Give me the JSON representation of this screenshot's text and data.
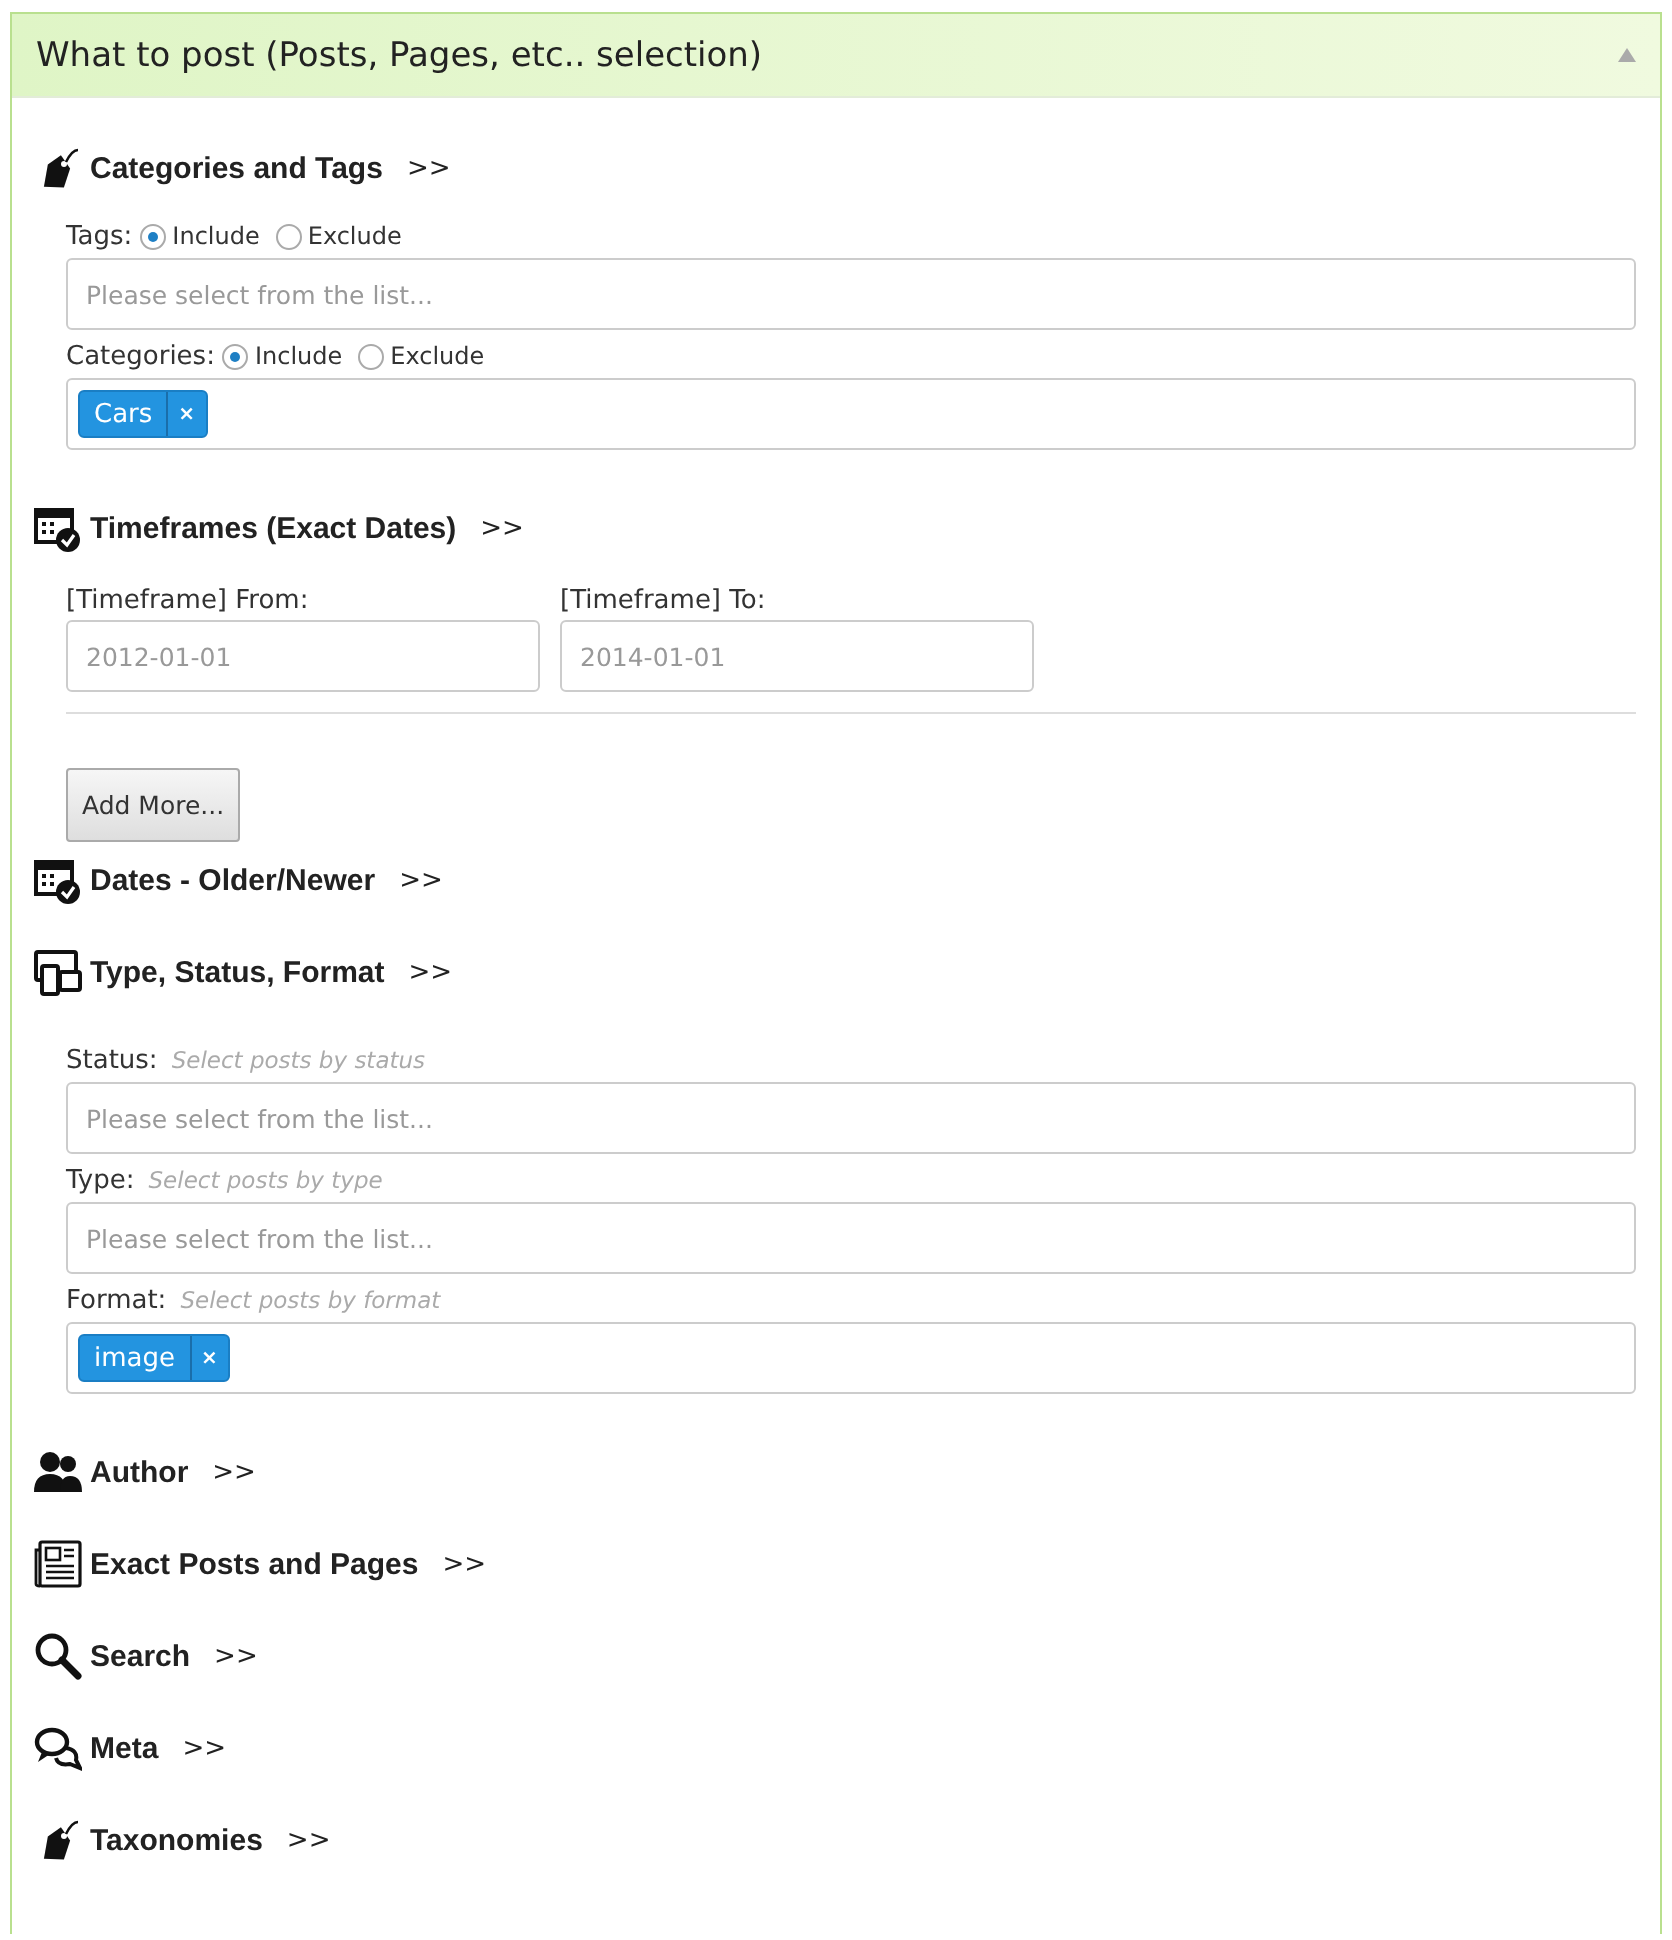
{
  "panel": {
    "title": "What to post (Posts, Pages, etc.. selection)"
  },
  "sections": [
    {
      "kind": "tag",
      "title": "Categories and Tags",
      "arrow": ">>",
      "rows": [
        {
          "kind": "choice",
          "label": "Tags:",
          "options": [
            {
              "label": "Include",
              "selected": true
            },
            {
              "label": "Exclude",
              "selected": false
            }
          ],
          "field": {
            "placeholder": "Please select from the list..."
          }
        },
        {
          "kind": "choice",
          "label": "Categories:",
          "options": [
            {
              "label": "Include",
              "selected": true
            },
            {
              "label": "Exclude",
              "selected": false
            }
          ],
          "field": {
            "tags": [
              {
                "label": "Cars",
                "remove": "×"
              }
            ]
          }
        }
      ]
    },
    {
      "kind": "calendar",
      "title": "Timeframes (Exact Dates)",
      "arrow": ">>",
      "rows": [
        {
          "kind": "dates",
          "fields": [
            {
              "label": "[Timeframe] From:",
              "placeholder": "2012-01-01"
            },
            {
              "label": "[Timeframe] To:",
              "placeholder": "2014-01-01"
            }
          ]
        },
        {
          "kind": "button",
          "label": "Add More..."
        }
      ]
    },
    {
      "kind": "calendar",
      "title": "Dates - Older/Newer",
      "arrow": ">>"
    },
    {
      "kind": "devices",
      "title": "Type, Status, Format",
      "arrow": ">>",
      "rows": [
        {
          "kind": "hinted",
          "label": "Status:",
          "hint": "Select posts by status",
          "field": {
            "placeholder": "Please select from the list..."
          }
        },
        {
          "kind": "hinted",
          "label": "Type:",
          "hint": "Select posts by type",
          "field": {
            "placeholder": "Please select from the list..."
          }
        },
        {
          "kind": "hinted",
          "label": "Format:",
          "hint": "Select posts by format",
          "field": {
            "tags": [
              {
                "label": "image",
                "remove": "×"
              }
            ]
          }
        }
      ]
    },
    {
      "kind": "users",
      "title": "Author",
      "arrow": ">>"
    },
    {
      "kind": "newspaper",
      "title": "Exact Posts and Pages",
      "arrow": ">>"
    },
    {
      "kind": "search",
      "title": "Search",
      "arrow": ">>"
    },
    {
      "kind": "chat",
      "title": "Meta",
      "arrow": ">>"
    },
    {
      "kind": "tag",
      "title": "Taxonomies",
      "arrow": ">>"
    }
  ]
}
